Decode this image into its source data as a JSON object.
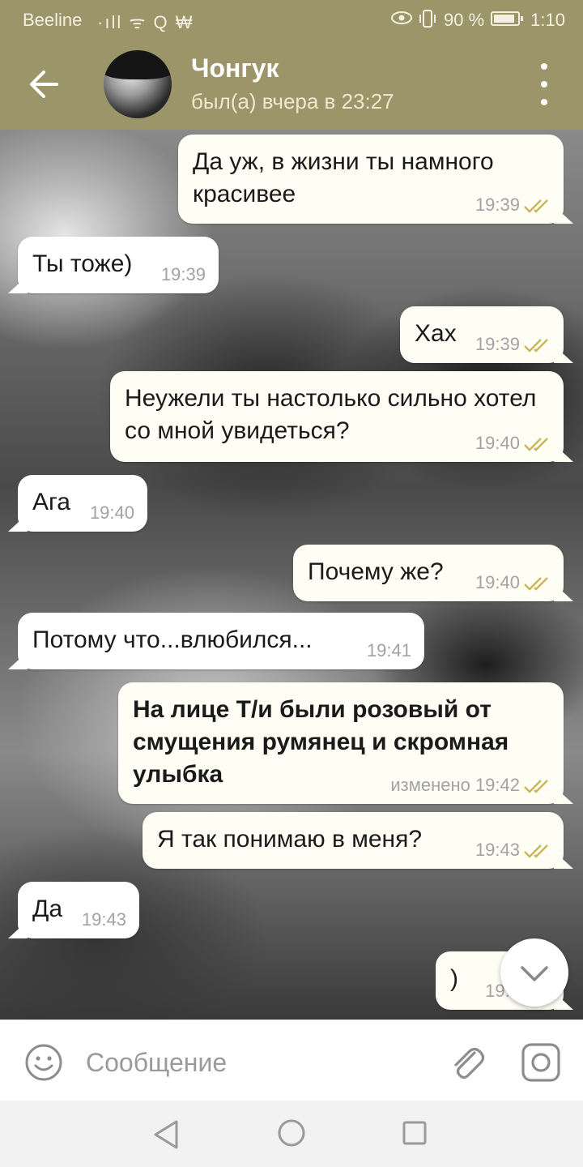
{
  "statusbar": {
    "carrier": "Beeline",
    "icons": "·ıll ᯤ Q ₩",
    "battery_text": "90 %",
    "battery_level": 0.9,
    "time": "1:10"
  },
  "header": {
    "name": "Чонгук",
    "status": "был(а) вчера в 23:27"
  },
  "messages": [
    {
      "dir": "out",
      "text": "Да уж, в жизни ты намного красивее",
      "time": "19:39",
      "read": true
    },
    {
      "dir": "in",
      "text": "Ты тоже)",
      "time": "19:39"
    },
    {
      "dir": "out",
      "text": "Хах",
      "time": "19:39",
      "read": true
    },
    {
      "dir": "out",
      "text": "Неужели ты настолько сильно хотел со мной увидеться?",
      "time": "19:40",
      "read": true
    },
    {
      "dir": "in",
      "text": "Ага",
      "time": "19:40"
    },
    {
      "dir": "out",
      "text": "Почему же?",
      "time": "19:40",
      "read": true
    },
    {
      "dir": "in",
      "text": "Потому что...влюбился...",
      "time": "19:41"
    },
    {
      "dir": "out",
      "text": "На лице Т/и были розовый от смущения румянец и скромная улыбка",
      "time": "изменено 19:42",
      "read": true,
      "bold": true
    },
    {
      "dir": "out",
      "text": "Я так понимаю в меня?",
      "time": "19:43",
      "read": true
    },
    {
      "dir": "in",
      "text": "Да",
      "time": "19:43"
    },
    {
      "dir": "out",
      "text": ")",
      "time": "19:4",
      "read": true
    }
  ],
  "composer": {
    "placeholder": "Сообщение"
  },
  "colors": {
    "header": "#9c9569",
    "outgoing_bubble": "#fffef5",
    "incoming_bubble": "#ffffff",
    "check": "#c9b65a"
  }
}
